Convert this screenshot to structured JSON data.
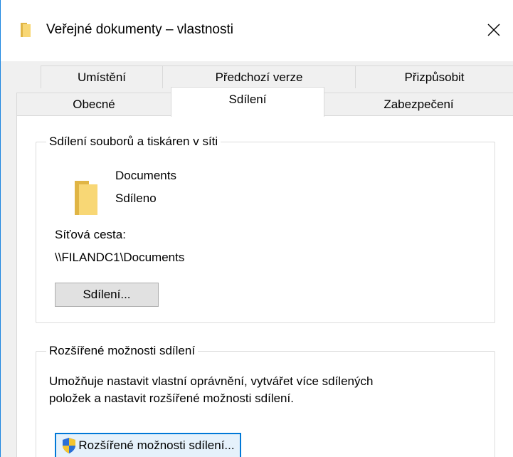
{
  "window": {
    "title": "Veřejné dokumenty – vlastnosti",
    "close_glyph": "✕",
    "icon": "folder-icon"
  },
  "tabs": {
    "row_top": [
      {
        "label": "Umístění"
      },
      {
        "label": "Předchozí verze"
      },
      {
        "label": "Přizpůsobit"
      }
    ],
    "row_bottom": [
      {
        "label": "Obecné"
      },
      {
        "label": "Sdílení",
        "active": true
      },
      {
        "label": "Zabezpečení"
      }
    ]
  },
  "network_sharing": {
    "legend": "Sdílení souborů a tiskáren v síti",
    "folder_name": "Documents",
    "status": "Sdíleno",
    "path_label": "Síťová cesta:",
    "path_value": "\\\\FILANDC1\\Documents",
    "share_button": "Sdílení..."
  },
  "advanced_sharing": {
    "legend": "Rozšířené možnosti sdílení",
    "description_line1": "Umožňuje nastavit vlastní oprávnění, vytvářet více sdílených",
    "description_line2": "položek a nastavit rozšířené možnosti sdílení.",
    "button": "Rozšířené možnosti sdílení..."
  },
  "colors": {
    "window_border": "#1a84e0",
    "tab_background": "#f0f0f0",
    "panel_background": "#ffffff",
    "button_background": "#e1e1e1",
    "focus_border": "#0078d7",
    "folder_yellow": "#f8d775",
    "folder_dark": "#e0b545"
  }
}
